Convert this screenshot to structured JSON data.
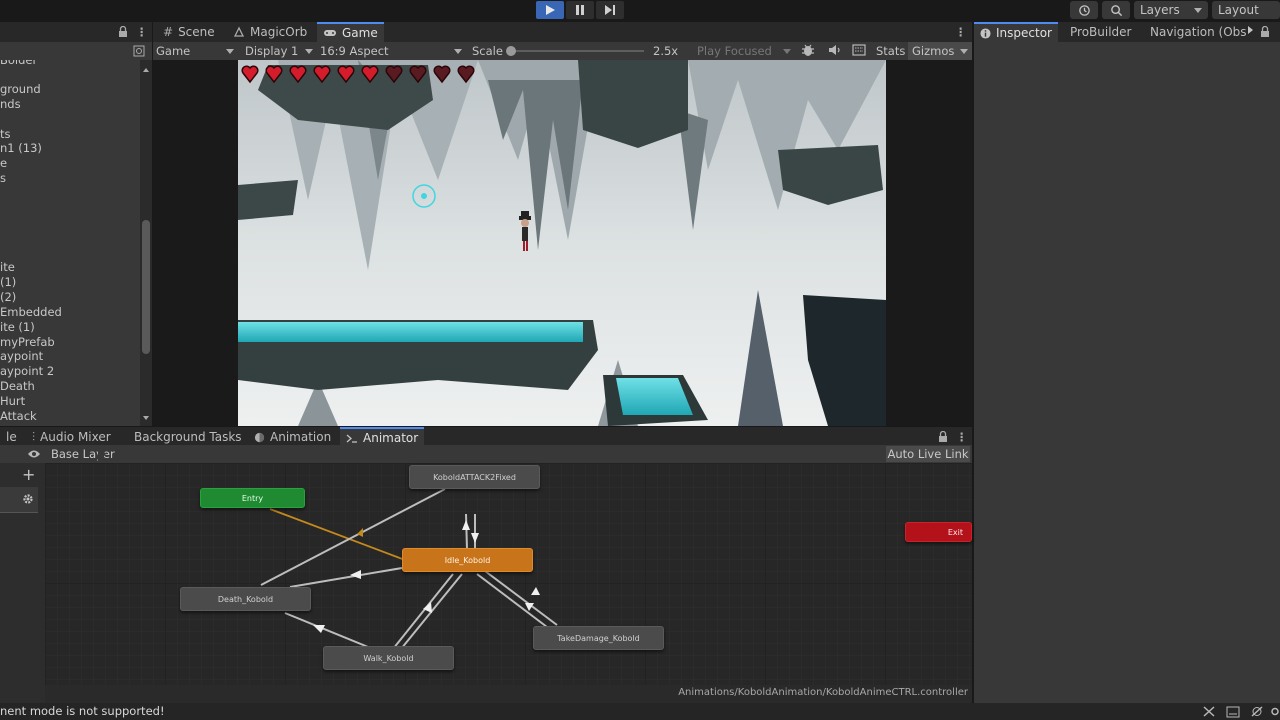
{
  "toolbar": {
    "layers_label": "Layers",
    "layout_label": "Layout"
  },
  "hierarchy": {
    "items": [
      "Bolder",
      "ground",
      "nds",
      "ts",
      "n1 (13)",
      "e",
      "s",
      "ite",
      "(1)",
      "(2)",
      "Embedded",
      "ite (1)",
      "myPrefab",
      "aypoint",
      "aypoint 2",
      "Death",
      "Hurt",
      "Attack"
    ]
  },
  "center_tabs": {
    "scene": "Scene",
    "magicorb": "MagicOrb",
    "game": "Game"
  },
  "game_toolbar": {
    "view": "Game",
    "display": "Display 1",
    "aspect": "16:9 Aspect",
    "scale_label": "Scale",
    "scale_value": "2.5x",
    "scale_fraction": 0.0,
    "play_focused": "Play Focused",
    "stats": "Stats",
    "gizmos": "Gizmos"
  },
  "hud": {
    "hearts_total": 10,
    "hearts_full": 6
  },
  "right_tabs": {
    "inspector": "Inspector",
    "probuilder": "ProBuilder",
    "navigation": "Navigation (Obs"
  },
  "bottom_tabs": {
    "partial": "le",
    "audio_mixer": "Audio Mixer",
    "background_tasks": "Background Tasks",
    "animation": "Animation",
    "animator": "Animator"
  },
  "animator": {
    "base_layer": "Base Layer",
    "auto_live_link": "Auto Live Link",
    "path": "Animations/KoboldAnimation/KoboldAnimeCTRL.controller",
    "nodes": {
      "attack": "KoboldATTACK2Fixed",
      "entry": "Entry",
      "idle": "Idle_Kobold",
      "exit": "Exit",
      "death": "Death_Kobold",
      "takedamage": "TakeDamage_Kobold",
      "walk": "Walk_Kobold"
    }
  },
  "status": {
    "message": "nent mode is not supported!"
  },
  "colors": {
    "accent": "#4d8cf0",
    "entry": "#1f8a32",
    "exit": "#b3121b",
    "default_state": "#c8741b",
    "heart_full": "#d41c2c",
    "heart_empty": "#5a1a22"
  }
}
